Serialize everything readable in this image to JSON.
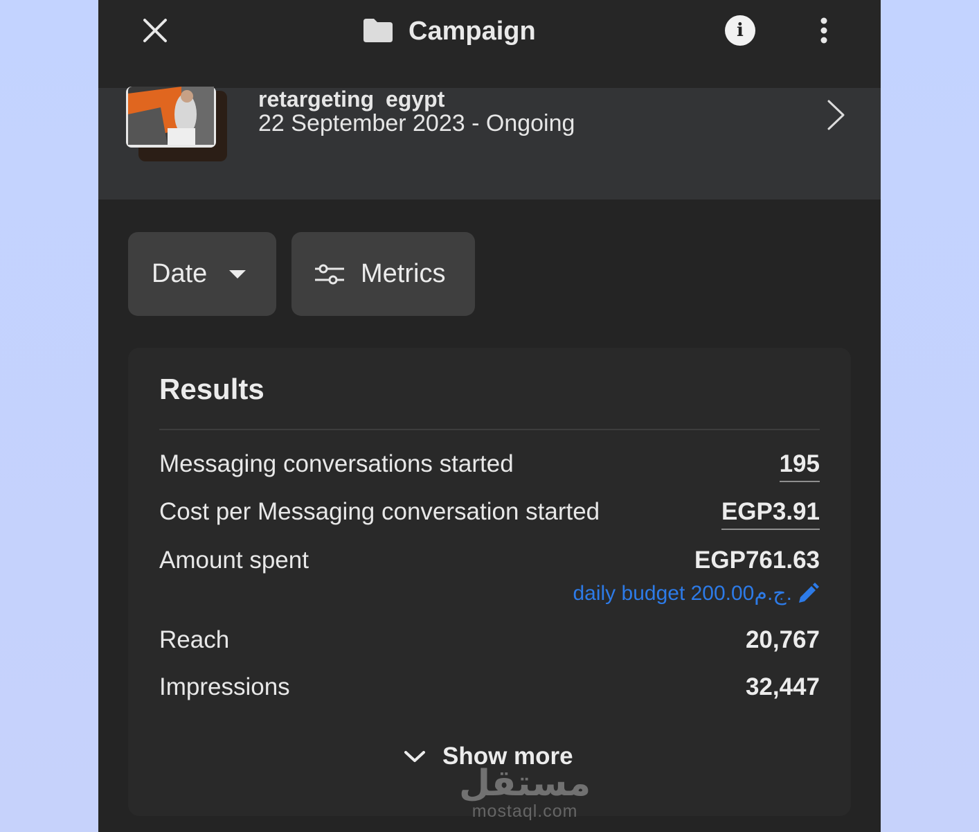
{
  "topbar": {
    "title": "Campaign",
    "close_icon": "close-icon",
    "folder_icon": "folder-icon",
    "info_icon": "info-icon",
    "more_icon": "more-vertical-icon"
  },
  "campaign": {
    "name": "retargeting  egypt",
    "date_range": "22 September 2023 -  Ongoing"
  },
  "filters": {
    "date_label": "Date",
    "metrics_label": "Metrics"
  },
  "results": {
    "title": "Results",
    "rows": [
      {
        "label": "Messaging conversations started",
        "value": "195"
      },
      {
        "label": "Cost per Messaging conversation started",
        "value": "EGP3.91"
      },
      {
        "label": "Amount spent",
        "value": "EGP761.63"
      },
      {
        "label": "Reach",
        "value": "20,767"
      },
      {
        "label": "Impressions",
        "value": "32,447"
      }
    ],
    "budget": "daily budget 200.00ج.م.",
    "show_more": "Show more"
  },
  "watermark": {
    "logo": "مستقل",
    "text": "mostaql.com"
  },
  "colors": {
    "background": "#242424",
    "header_row": "#333436",
    "button": "#3f3f3f",
    "link": "#2d7be8"
  }
}
